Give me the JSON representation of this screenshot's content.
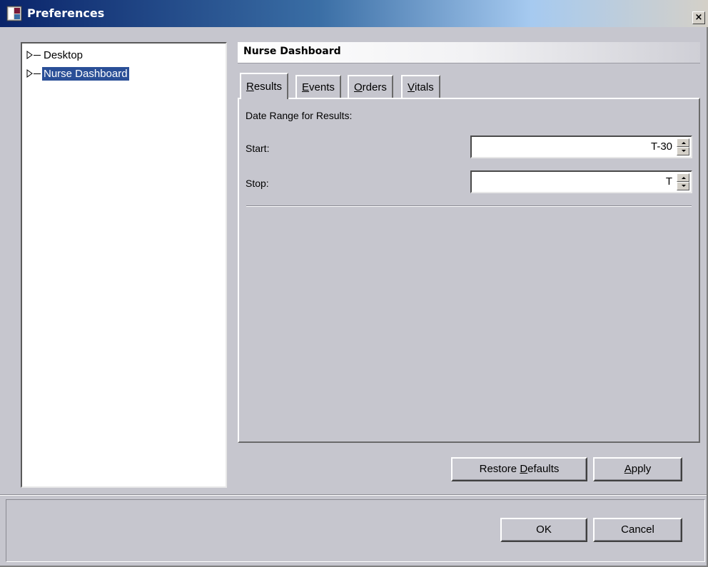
{
  "window": {
    "title": "Preferences",
    "close_glyph": "×",
    "icon": "preferences-app-icon"
  },
  "tree": {
    "items": [
      {
        "label": "Desktop",
        "selected": false
      },
      {
        "label": "Nurse Dashboard",
        "selected": true
      }
    ]
  },
  "section": {
    "title": "Nurse Dashboard"
  },
  "tabs": [
    {
      "pre": "",
      "mnemonic": "R",
      "post": "esults",
      "active": true
    },
    {
      "pre": "",
      "mnemonic": "E",
      "post": "vents",
      "active": false
    },
    {
      "pre": "",
      "mnemonic": "O",
      "post": "rders",
      "active": false
    },
    {
      "pre": "",
      "mnemonic": "V",
      "post": "itals",
      "active": false
    }
  ],
  "results": {
    "date_range_label": "Date Range for Results:",
    "start_label": "Start:",
    "start_value": "T-30",
    "stop_label": "Stop:",
    "stop_value": "T"
  },
  "buttons": {
    "restore": {
      "pre": "Restore ",
      "mnemonic": "D",
      "post": "efaults"
    },
    "apply": {
      "pre": "",
      "mnemonic": "A",
      "post": "pply"
    },
    "ok": {
      "label": "OK"
    },
    "cancel": {
      "label": "Cancel"
    }
  },
  "colors": {
    "title_bar": "#0a246a",
    "selection": "#2a4f97",
    "face": "#c6c6ce"
  }
}
